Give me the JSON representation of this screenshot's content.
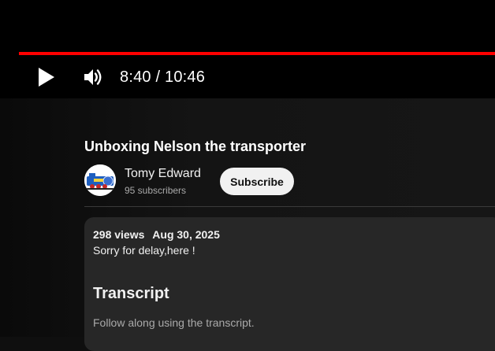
{
  "player": {
    "current_time": "8:40",
    "separator": "/",
    "duration": "10:46",
    "time_display": "8:40 / 10:46",
    "progress_fraction": 0.805,
    "progress_color": "#ff0000",
    "play_icon": "play-icon",
    "volume_icon": "volume-icon"
  },
  "video": {
    "title": "Unboxing Nelson the transporter"
  },
  "channel": {
    "name": "Tomy Edward",
    "subscribers": "95 subscribers",
    "subscribe_label": "Subscribe"
  },
  "description": {
    "views": "298 views",
    "date": "Aug 30, 2025",
    "text": "Sorry for delay,here !"
  },
  "transcript": {
    "heading": "Transcript",
    "subtext": "Follow along using the transcript."
  }
}
